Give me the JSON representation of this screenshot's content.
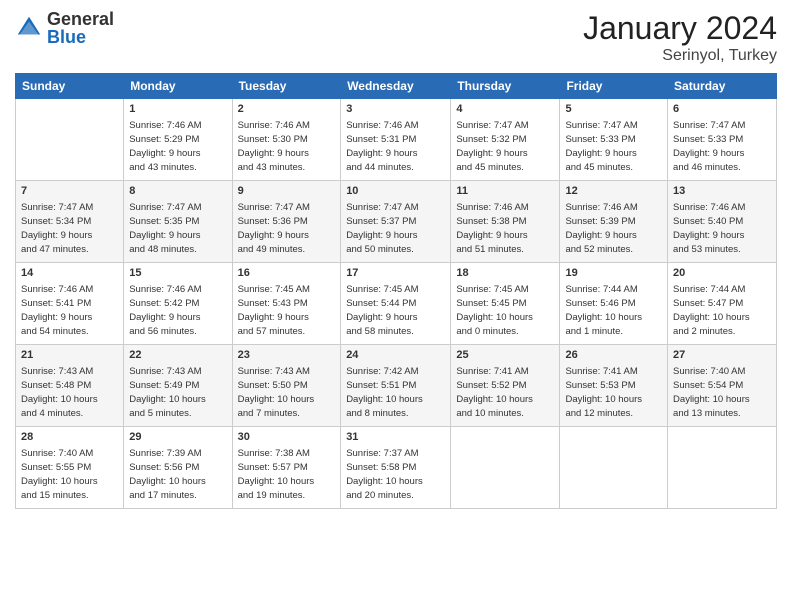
{
  "header": {
    "logo_general": "General",
    "logo_blue": "Blue",
    "month": "January 2024",
    "location": "Serinyol, Turkey"
  },
  "days_of_week": [
    "Sunday",
    "Monday",
    "Tuesday",
    "Wednesday",
    "Thursday",
    "Friday",
    "Saturday"
  ],
  "weeks": [
    [
      {
        "day": "",
        "info": ""
      },
      {
        "day": "1",
        "info": "Sunrise: 7:46 AM\nSunset: 5:29 PM\nDaylight: 9 hours\nand 43 minutes."
      },
      {
        "day": "2",
        "info": "Sunrise: 7:46 AM\nSunset: 5:30 PM\nDaylight: 9 hours\nand 43 minutes."
      },
      {
        "day": "3",
        "info": "Sunrise: 7:46 AM\nSunset: 5:31 PM\nDaylight: 9 hours\nand 44 minutes."
      },
      {
        "day": "4",
        "info": "Sunrise: 7:47 AM\nSunset: 5:32 PM\nDaylight: 9 hours\nand 45 minutes."
      },
      {
        "day": "5",
        "info": "Sunrise: 7:47 AM\nSunset: 5:33 PM\nDaylight: 9 hours\nand 45 minutes."
      },
      {
        "day": "6",
        "info": "Sunrise: 7:47 AM\nSunset: 5:33 PM\nDaylight: 9 hours\nand 46 minutes."
      }
    ],
    [
      {
        "day": "7",
        "info": "Sunrise: 7:47 AM\nSunset: 5:34 PM\nDaylight: 9 hours\nand 47 minutes."
      },
      {
        "day": "8",
        "info": "Sunrise: 7:47 AM\nSunset: 5:35 PM\nDaylight: 9 hours\nand 48 minutes."
      },
      {
        "day": "9",
        "info": "Sunrise: 7:47 AM\nSunset: 5:36 PM\nDaylight: 9 hours\nand 49 minutes."
      },
      {
        "day": "10",
        "info": "Sunrise: 7:47 AM\nSunset: 5:37 PM\nDaylight: 9 hours\nand 50 minutes."
      },
      {
        "day": "11",
        "info": "Sunrise: 7:46 AM\nSunset: 5:38 PM\nDaylight: 9 hours\nand 51 minutes."
      },
      {
        "day": "12",
        "info": "Sunrise: 7:46 AM\nSunset: 5:39 PM\nDaylight: 9 hours\nand 52 minutes."
      },
      {
        "day": "13",
        "info": "Sunrise: 7:46 AM\nSunset: 5:40 PM\nDaylight: 9 hours\nand 53 minutes."
      }
    ],
    [
      {
        "day": "14",
        "info": "Sunrise: 7:46 AM\nSunset: 5:41 PM\nDaylight: 9 hours\nand 54 minutes."
      },
      {
        "day": "15",
        "info": "Sunrise: 7:46 AM\nSunset: 5:42 PM\nDaylight: 9 hours\nand 56 minutes."
      },
      {
        "day": "16",
        "info": "Sunrise: 7:45 AM\nSunset: 5:43 PM\nDaylight: 9 hours\nand 57 minutes."
      },
      {
        "day": "17",
        "info": "Sunrise: 7:45 AM\nSunset: 5:44 PM\nDaylight: 9 hours\nand 58 minutes."
      },
      {
        "day": "18",
        "info": "Sunrise: 7:45 AM\nSunset: 5:45 PM\nDaylight: 10 hours\nand 0 minutes."
      },
      {
        "day": "19",
        "info": "Sunrise: 7:44 AM\nSunset: 5:46 PM\nDaylight: 10 hours\nand 1 minute."
      },
      {
        "day": "20",
        "info": "Sunrise: 7:44 AM\nSunset: 5:47 PM\nDaylight: 10 hours\nand 2 minutes."
      }
    ],
    [
      {
        "day": "21",
        "info": "Sunrise: 7:43 AM\nSunset: 5:48 PM\nDaylight: 10 hours\nand 4 minutes."
      },
      {
        "day": "22",
        "info": "Sunrise: 7:43 AM\nSunset: 5:49 PM\nDaylight: 10 hours\nand 5 minutes."
      },
      {
        "day": "23",
        "info": "Sunrise: 7:43 AM\nSunset: 5:50 PM\nDaylight: 10 hours\nand 7 minutes."
      },
      {
        "day": "24",
        "info": "Sunrise: 7:42 AM\nSunset: 5:51 PM\nDaylight: 10 hours\nand 8 minutes."
      },
      {
        "day": "25",
        "info": "Sunrise: 7:41 AM\nSunset: 5:52 PM\nDaylight: 10 hours\nand 10 minutes."
      },
      {
        "day": "26",
        "info": "Sunrise: 7:41 AM\nSunset: 5:53 PM\nDaylight: 10 hours\nand 12 minutes."
      },
      {
        "day": "27",
        "info": "Sunrise: 7:40 AM\nSunset: 5:54 PM\nDaylight: 10 hours\nand 13 minutes."
      }
    ],
    [
      {
        "day": "28",
        "info": "Sunrise: 7:40 AM\nSunset: 5:55 PM\nDaylight: 10 hours\nand 15 minutes."
      },
      {
        "day": "29",
        "info": "Sunrise: 7:39 AM\nSunset: 5:56 PM\nDaylight: 10 hours\nand 17 minutes."
      },
      {
        "day": "30",
        "info": "Sunrise: 7:38 AM\nSunset: 5:57 PM\nDaylight: 10 hours\nand 19 minutes."
      },
      {
        "day": "31",
        "info": "Sunrise: 7:37 AM\nSunset: 5:58 PM\nDaylight: 10 hours\nand 20 minutes."
      },
      {
        "day": "",
        "info": ""
      },
      {
        "day": "",
        "info": ""
      },
      {
        "day": "",
        "info": ""
      }
    ]
  ]
}
